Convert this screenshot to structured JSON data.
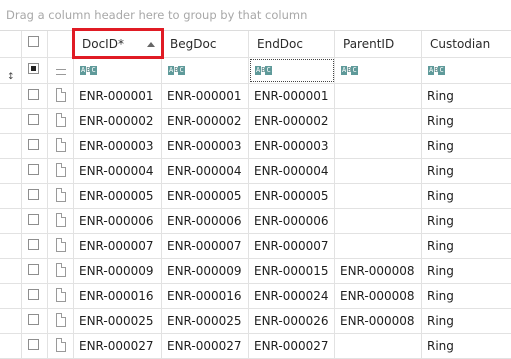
{
  "group_panel": {
    "hint": "Drag a column header here to group by that column"
  },
  "columns": [
    "DocID*",
    "BegDoc",
    "EndDoc",
    "ParentID",
    "Custodian"
  ],
  "sort": {
    "column": "DocID*",
    "direction": "ascending"
  },
  "filter_row": {
    "type_icon_label": "ABC",
    "pin_icon": "pin-icon",
    "select_all": "checked"
  },
  "rows": [
    [
      "ENR-000001",
      "ENR-000001",
      "ENR-000001",
      "",
      "Ring"
    ],
    [
      "ENR-000002",
      "ENR-000002",
      "ENR-000002",
      "",
      "Ring"
    ],
    [
      "ENR-000003",
      "ENR-000003",
      "ENR-000003",
      "",
      "Ring"
    ],
    [
      "ENR-000004",
      "ENR-000004",
      "ENR-000004",
      "",
      "Ring"
    ],
    [
      "ENR-000005",
      "ENR-000005",
      "ENR-000005",
      "",
      "Ring"
    ],
    [
      "ENR-000006",
      "ENR-000006",
      "ENR-000006",
      "",
      "Ring"
    ],
    [
      "ENR-000007",
      "ENR-000007",
      "ENR-000007",
      "",
      "Ring"
    ],
    [
      "ENR-000009",
      "ENR-000009",
      "ENR-000015",
      "ENR-000008",
      "Ring"
    ],
    [
      "ENR-000016",
      "ENR-000016",
      "ENR-000024",
      "ENR-000008",
      "Ring"
    ],
    [
      "ENR-000025",
      "ENR-000025",
      "ENR-000026",
      "ENR-000008",
      "Ring"
    ],
    [
      "ENR-000027",
      "ENR-000027",
      "ENR-000027",
      "",
      "Ring"
    ]
  ],
  "colors": {
    "highlight": "#e01b24",
    "grid_line": "#e2e2e2",
    "hint_text": "#a8a8a8"
  }
}
